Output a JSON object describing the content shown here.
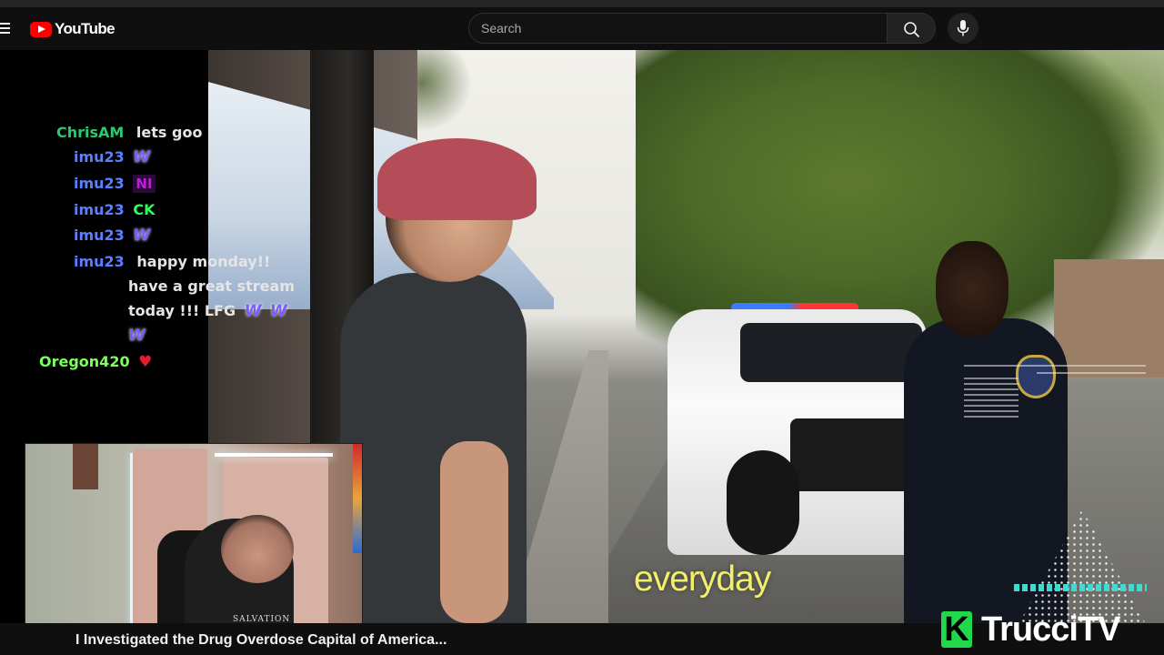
{
  "app": {
    "logo_text": "YouTube",
    "accent_color": "#ff0000"
  },
  "search": {
    "placeholder": "Search"
  },
  "icons": {
    "menu": "hamburger-menu-icon",
    "search": "search-icon",
    "mic": "mic-icon",
    "logo": "youtube-logo-icon"
  },
  "chat": {
    "messages": [
      {
        "user": "ChrisAM",
        "user_color": "#29c970",
        "text": "lets goo",
        "emotes": []
      },
      {
        "user": "imu23",
        "user_color": "#5b7fff",
        "text": "",
        "emotes": [
          "W"
        ]
      },
      {
        "user": "imu23",
        "user_color": "#5b7fff",
        "text": "",
        "emotes": [
          "NI"
        ]
      },
      {
        "user": "imu23",
        "user_color": "#5b7fff",
        "text": "",
        "emotes": [
          "CK"
        ]
      },
      {
        "user": "imu23",
        "user_color": "#5b7fff",
        "text": "",
        "emotes": [
          "W"
        ]
      },
      {
        "user": "imu23",
        "user_color": "#5b7fff",
        "text_lines": [
          "happy monday!!",
          "have a great stream",
          "today !!! LFG"
        ],
        "emotes": [
          "W",
          "W",
          "W"
        ]
      },
      {
        "user": "Oregon420",
        "user_color": "#7cff5a",
        "text": "",
        "emotes": [
          "heart"
        ]
      }
    ]
  },
  "video": {
    "subtitle": "everyday",
    "title": "I Investigated the Drug Overdose Capital of America...",
    "webcam_shirt_text": "SALVATION",
    "brand_mark": "K",
    "brand_name": "TrucciTV",
    "brand_color": "#20d84a",
    "subtitle_color": "#f2ef6a"
  }
}
